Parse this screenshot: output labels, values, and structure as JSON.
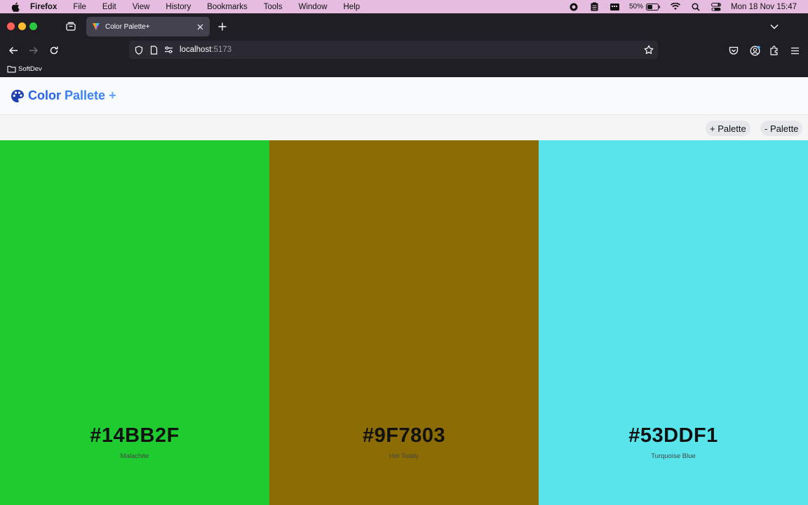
{
  "menubar": {
    "app": "Firefox",
    "items": [
      "File",
      "Edit",
      "View",
      "History",
      "Bookmarks",
      "Tools",
      "Window",
      "Help"
    ],
    "battery": "50%",
    "clock": "Mon 18 Nov  15:47"
  },
  "browser": {
    "tab_title": "Color Palette+",
    "url_host": "localhost",
    "url_port": ":5173",
    "bookmark_folder": "SoftDev"
  },
  "app": {
    "logo": {
      "word1": "Color",
      "word2": "Pallete",
      "word3": "+"
    },
    "add_palette_label": "+ Palette",
    "remove_palette_label": "- Palette",
    "colors": [
      {
        "hex": "#14BB2F",
        "name": "Malachite",
        "swatch": "#1fcc2f"
      },
      {
        "hex": "#9F7803",
        "name": "Hot Toddy",
        "swatch": "#8c6c04"
      },
      {
        "hex": "#53DDF1",
        "name": "Turquoise Blue",
        "swatch": "#57e5eb"
      }
    ]
  },
  "colors": {
    "menubar_bg": "#e6bde0",
    "chrome_bg": "#1f1e25",
    "accent": "#3b82f6"
  }
}
